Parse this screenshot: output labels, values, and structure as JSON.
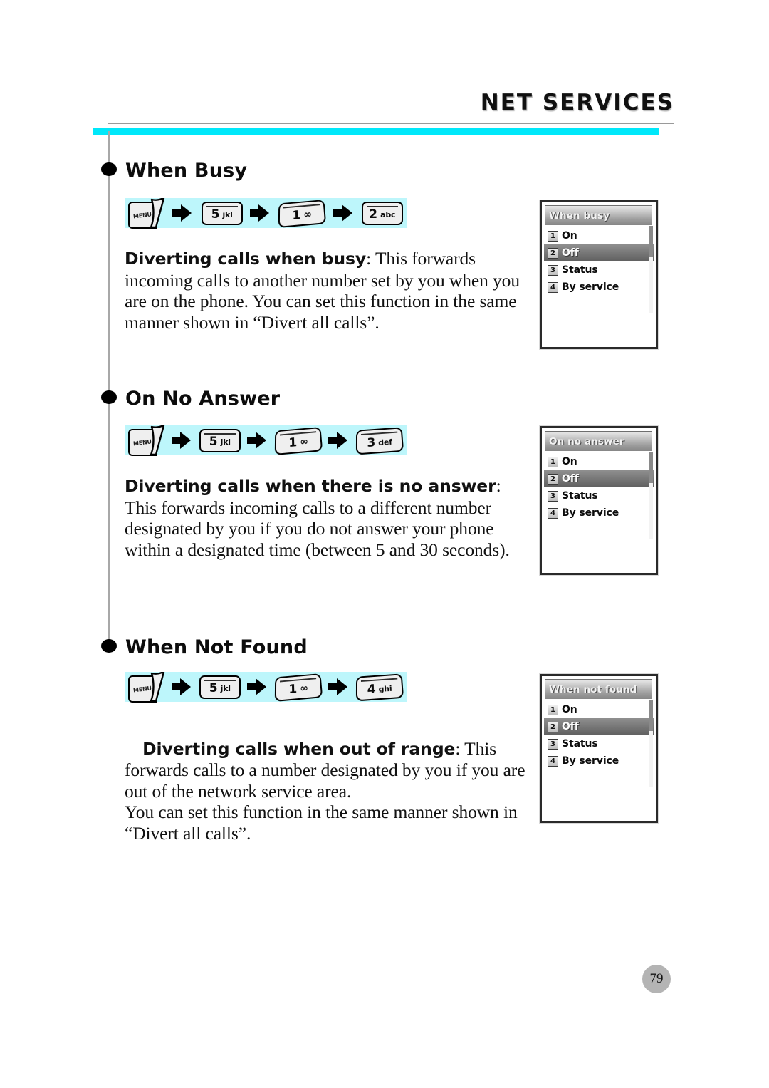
{
  "header": {
    "title": "NET SERVICES"
  },
  "page_number": "79",
  "sections": [
    {
      "heading": "When Busy",
      "keys": [
        {
          "type": "menu",
          "label": "MENU"
        },
        {
          "type": "flat",
          "digit": "5",
          "letters": "jkl"
        },
        {
          "type": "skew",
          "digit": "1",
          "letters": "∞"
        },
        {
          "type": "flat",
          "digit": "2",
          "letters": "abc"
        }
      ],
      "body_bold": "Diverting calls when busy",
      "body_text": ": This forwards incoming calls to another number set by you when you are on the phone. You can set this function in the same manner shown in “Divert all calls”.",
      "screen": {
        "title": "When busy",
        "items": [
          {
            "num": "1",
            "label": "On",
            "selected": false
          },
          {
            "num": "2",
            "label": "Off",
            "selected": true
          },
          {
            "num": "3",
            "label": "Status",
            "selected": false
          },
          {
            "num": "4",
            "label": "By service",
            "selected": false
          }
        ]
      }
    },
    {
      "heading": "On No Answer",
      "keys": [
        {
          "type": "menu",
          "label": "MENU"
        },
        {
          "type": "flat",
          "digit": "5",
          "letters": "jkl"
        },
        {
          "type": "skew",
          "digit": "1",
          "letters": "∞"
        },
        {
          "type": "skew",
          "digit": "3",
          "letters": "def"
        }
      ],
      "body_bold": "Diverting calls when there is no answer",
      "body_text": ": This forwards incoming calls to a different number designated by you if you do not answer your phone within a designated time (between 5 and 30 seconds).",
      "screen": {
        "title": "On no answer",
        "items": [
          {
            "num": "1",
            "label": "On",
            "selected": false
          },
          {
            "num": "2",
            "label": "Off",
            "selected": true
          },
          {
            "num": "3",
            "label": "Status",
            "selected": false
          },
          {
            "num": "4",
            "label": "By service",
            "selected": false
          }
        ]
      }
    },
    {
      "heading": "When Not Found",
      "keys": [
        {
          "type": "menu",
          "label": "MENU"
        },
        {
          "type": "flat",
          "digit": "5",
          "letters": "jkl"
        },
        {
          "type": "skew",
          "digit": "1",
          "letters": "∞"
        },
        {
          "type": "skew",
          "digit": "4",
          "letters": "ghi"
        }
      ],
      "body_bold": "Diverting calls when out of range",
      "body_text": ": This forwards calls to a number designated by you if you are out of the network service area.\nYou can set this function in the same manner shown in “Divert all calls”.",
      "screen": {
        "title": "When not found",
        "items": [
          {
            "num": "1",
            "label": "On",
            "selected": false
          },
          {
            "num": "2",
            "label": "Off",
            "selected": true
          },
          {
            "num": "3",
            "label": "Status",
            "selected": false
          },
          {
            "num": "4",
            "label": "By service",
            "selected": false
          }
        ]
      }
    }
  ],
  "colors": {
    "accent_bar": "#00e8fa",
    "key_band": "#bdf6fb",
    "rule": "#9a9a9a",
    "page_badge": "#b4b4b4"
  }
}
